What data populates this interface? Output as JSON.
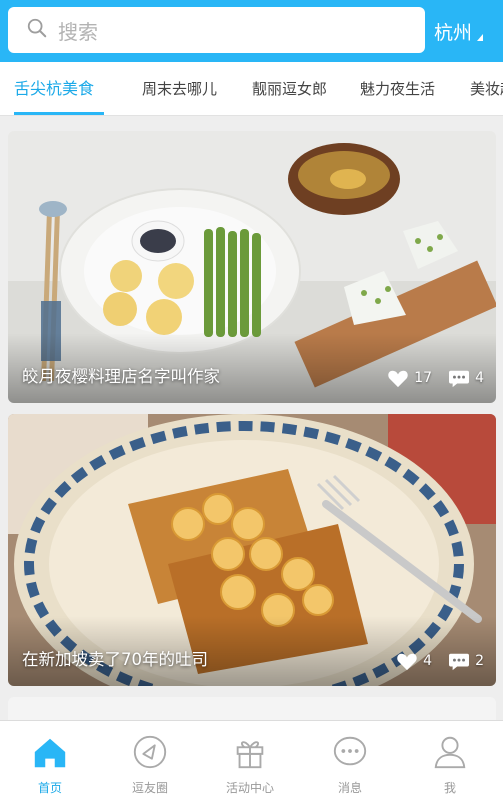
{
  "search": {
    "placeholder": "搜索",
    "icon": "search-icon"
  },
  "city": {
    "label": "杭州",
    "icon": "caret-icon"
  },
  "tabs": [
    {
      "label": "舌尖杭美食",
      "active": true
    },
    {
      "label": "周末去哪儿",
      "active": false
    },
    {
      "label": "靓丽逗女郎",
      "active": false
    },
    {
      "label": "魅力夜生活",
      "active": false
    },
    {
      "label": "美妆趣",
      "active": false
    }
  ],
  "feed": [
    {
      "title": "皎月夜樱料理店名字叫作家",
      "likes": "17",
      "comments": "4"
    },
    {
      "title": "在新加坡卖了70年的吐司",
      "likes": "4",
      "comments": "2"
    }
  ],
  "bottom_nav": [
    {
      "label": "首页",
      "icon": "home-icon",
      "active": true
    },
    {
      "label": "逗友圈",
      "icon": "friends-circle-icon",
      "active": false
    },
    {
      "label": "活动中心",
      "icon": "gift-icon",
      "active": false
    },
    {
      "label": "消息",
      "icon": "chat-bubble-icon",
      "active": false
    },
    {
      "label": "我",
      "icon": "person-icon",
      "active": false
    }
  ],
  "colors": {
    "accent": "#29b6f6",
    "accent_text": "#1ba9e8",
    "inactive_text": "#999999"
  }
}
